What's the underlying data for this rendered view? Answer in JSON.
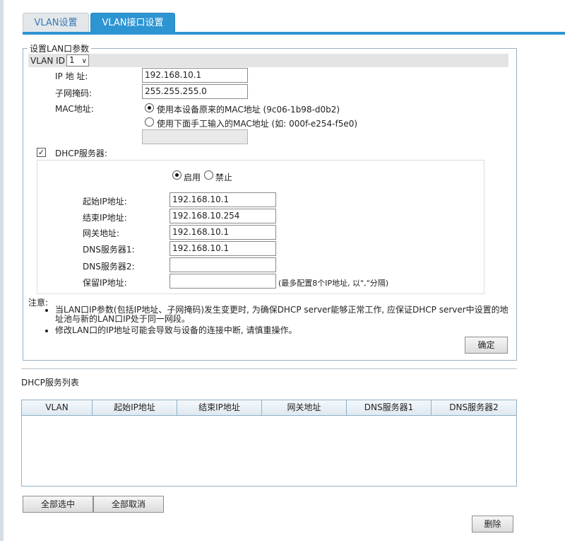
{
  "tabs": [
    "VLAN设置",
    "VLAN接口设置"
  ],
  "lan": {
    "legend": "设置LAN口参数",
    "vlan_id_label": "VLAN ID",
    "vlan_id_value": "1",
    "ip_label": "IP 地 址:",
    "ip_value": "192.168.10.1",
    "mask_label": "子网掩码:",
    "mask_value": "255.255.255.0",
    "mac_label": "MAC地址:",
    "mac_option_default": "使用本设备原来的MAC地址  (9c06-1b98-d0b2)",
    "mac_option_manual": "使用下面手工输入的MAC地址 (如: 000f-e254-f5e0)",
    "mac_manual_value": ""
  },
  "dhcp": {
    "label": "DHCP服务器:",
    "enabled_checked": true,
    "enable_label": "启用",
    "disable_label": "禁止",
    "start_label": "起始IP地址:",
    "start_value": "192.168.10.1",
    "end_label": "结束IP地址:",
    "end_value": "192.168.10.254",
    "gateway_label": "网关地址:",
    "gateway_value": "192.168.10.1",
    "dns1_label": "DNS服务器1:",
    "dns1_value": "192.168.10.1",
    "dns2_label": "DNS服务器2:",
    "dns2_value": "",
    "reserved_label": "保留IP地址:",
    "reserved_value": "",
    "reserved_hint": "(最多配置8个IP地址, 以\",\"分隔)"
  },
  "notes": {
    "title": "注意:",
    "items": [
      "当LAN口IP参数(包括IP地址、子网掩码)发生变更时, 为确保DHCP server能够正常工作, 应保证DHCP server中设置的地址池与新的LAN口IP处于同一网段。",
      "修改LAN口的IP地址可能会导致与设备的连接中断, 请慎重操作。"
    ]
  },
  "confirm_label": "确定",
  "table": {
    "title": "DHCP服务列表",
    "columns": [
      "VLAN",
      "起始IP地址",
      "结束IP地址",
      "网关地址",
      "DNS服务器1",
      "DNS服务器2"
    ]
  },
  "buttons": {
    "select_all": "全部选中",
    "deselect_all": "全部取消",
    "delete": "删除"
  }
}
